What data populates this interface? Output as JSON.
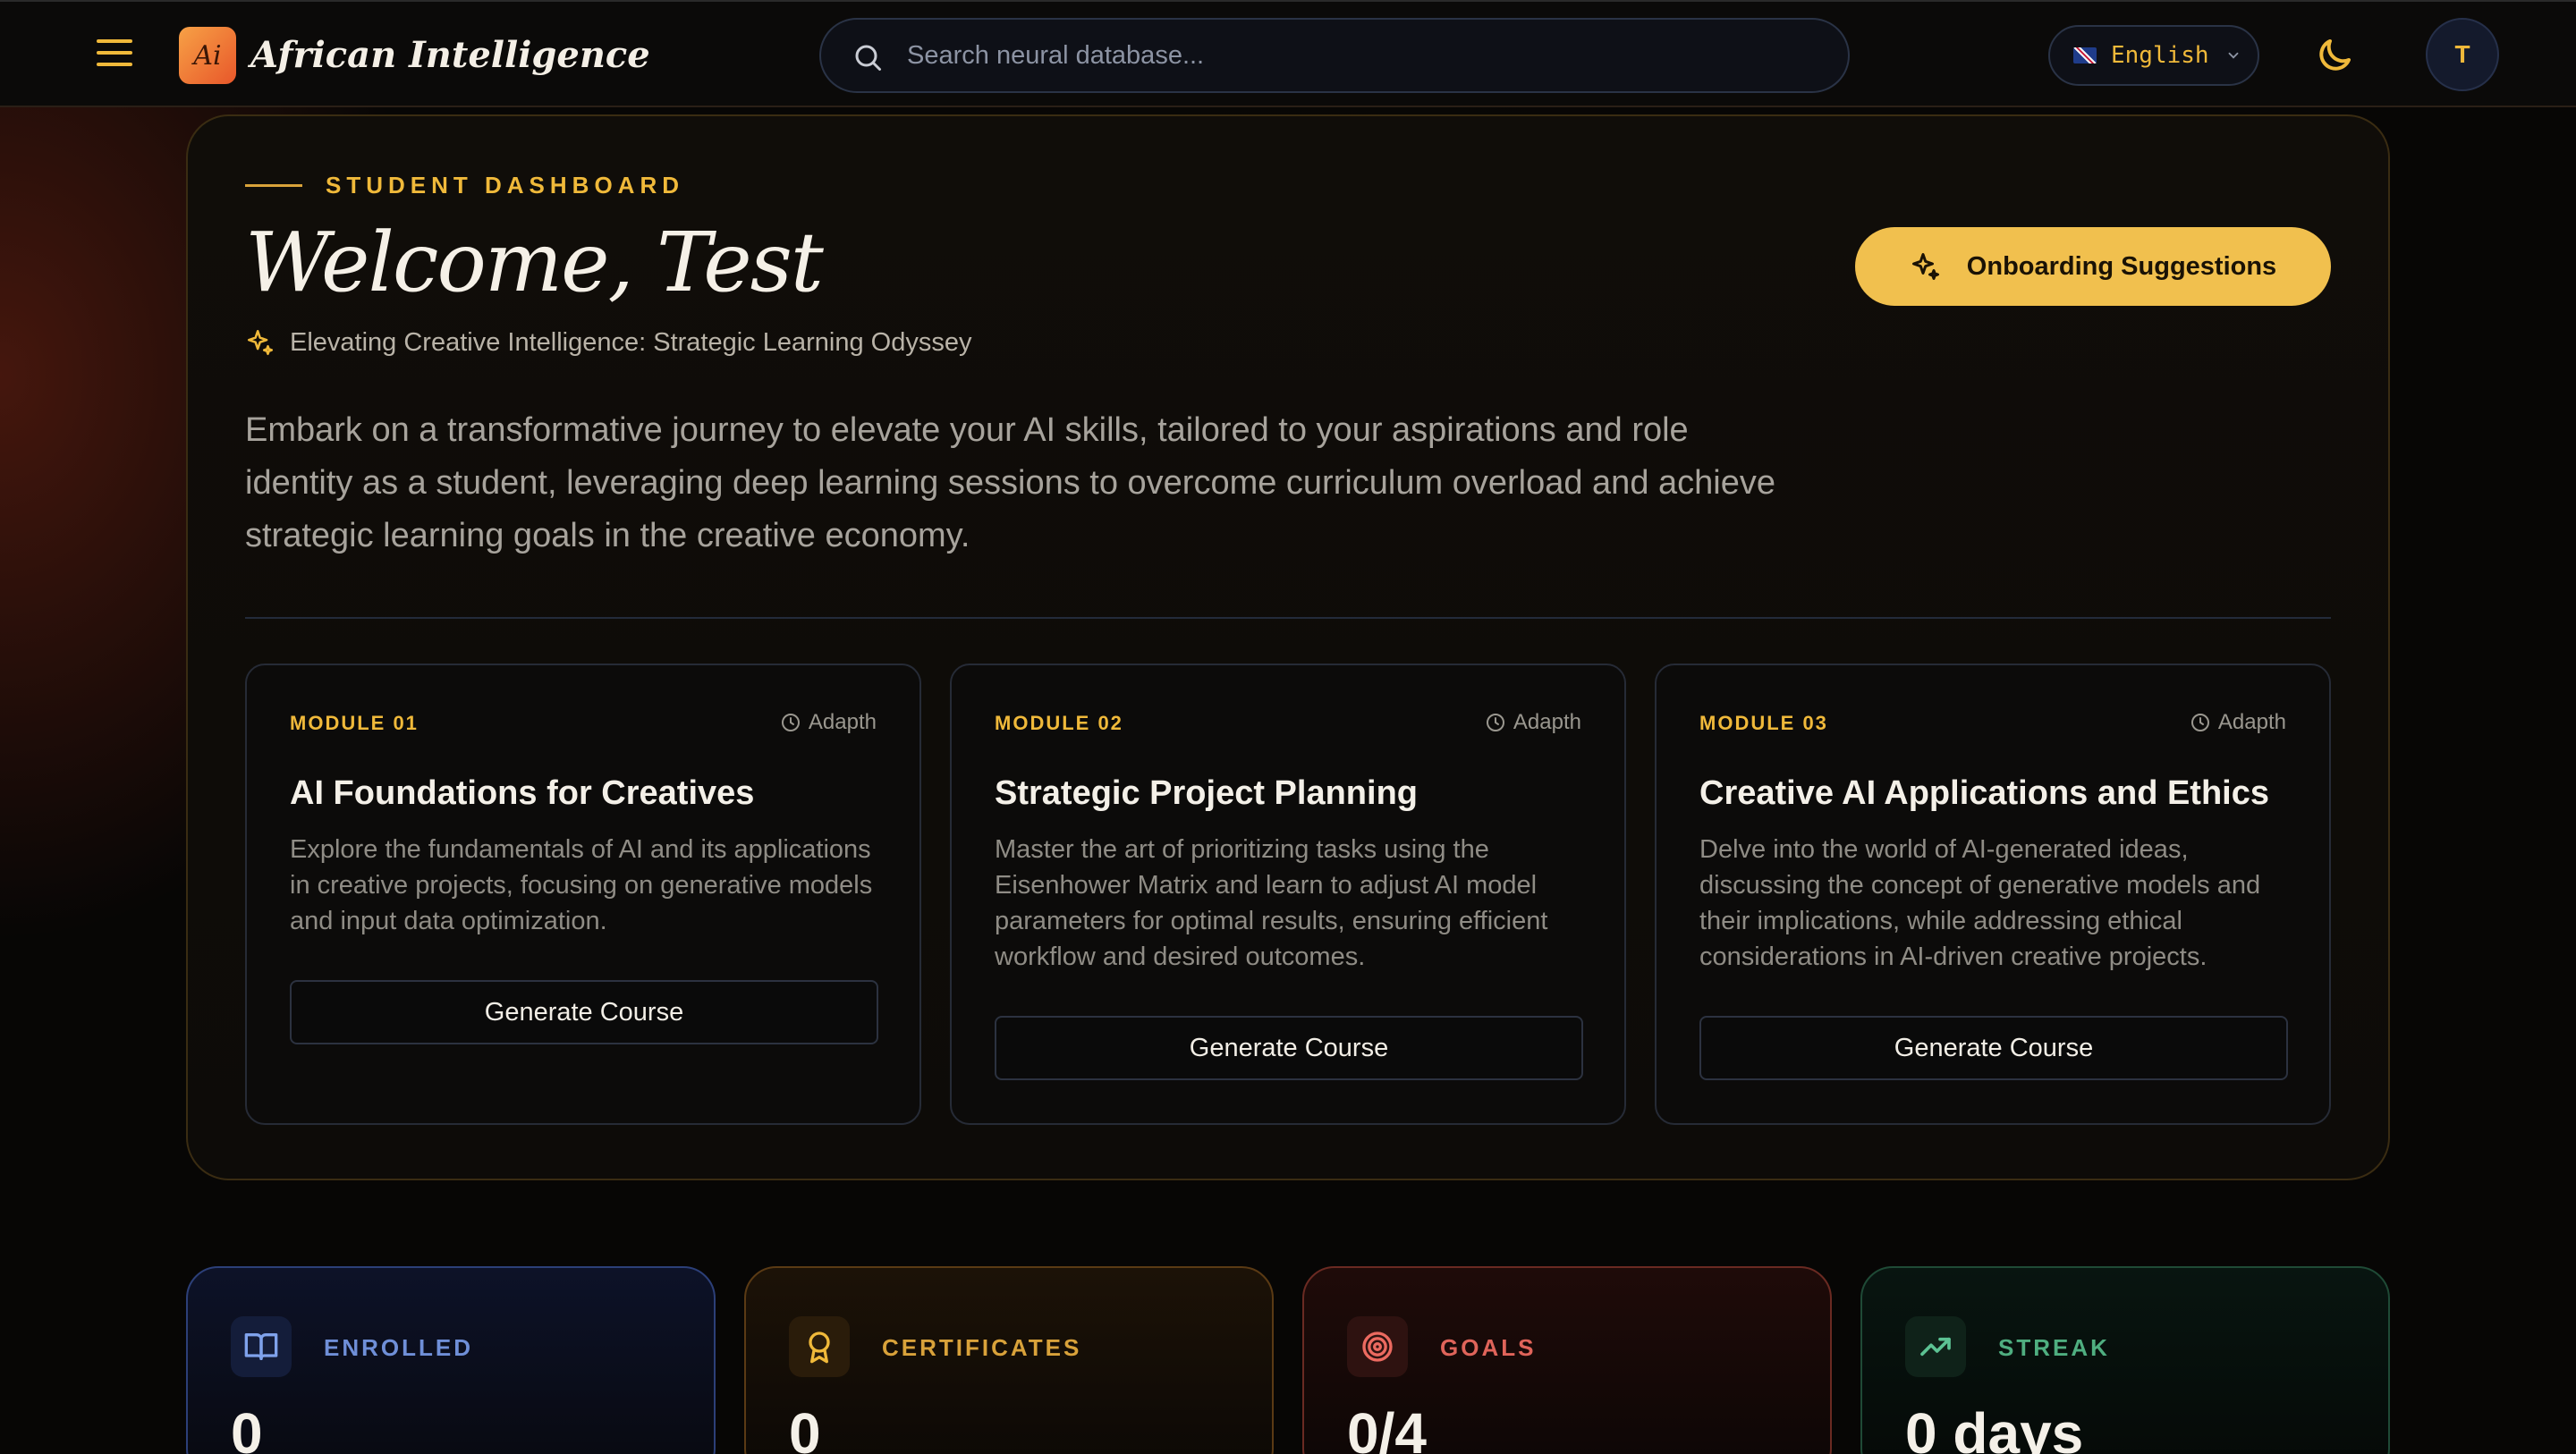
{
  "nav": {
    "logo_text": "Ai",
    "brand": "African Intelligence",
    "search_placeholder": "Search neural database...",
    "language": "English",
    "avatar_initial": "T"
  },
  "hero": {
    "eyebrow": "STUDENT DASHBOARD",
    "welcome": "Welcome, Test",
    "tagline": "Elevating Creative Intelligence: Strategic Learning Odyssey",
    "description": "Embark on a transformative journey to elevate your AI skills, tailored to your aspirations and role identity as a student, leveraging deep learning sessions to overcome curriculum overload and achieve strategic learning goals in the creative economy.",
    "onboarding_button": "Onboarding Suggestions"
  },
  "modules": [
    {
      "number": "MODULE 01",
      "tag": "Adapth",
      "title": "AI Foundations for Creatives",
      "description": "Explore the fundamentals of AI and its applications in creative projects, focusing on generative models and input data optimization.",
      "button": "Generate Course"
    },
    {
      "number": "MODULE 02",
      "tag": "Adapth",
      "title": "Strategic Project Planning",
      "description": "Master the art of prioritizing tasks using the Eisenhower Matrix and learn to adjust AI model parameters for optimal results, ensuring efficient workflow and desired outcomes.",
      "button": "Generate Course"
    },
    {
      "number": "MODULE 03",
      "tag": "Adapth",
      "title": "Creative AI Applications and Ethics",
      "description": "Delve into the world of AI-generated ideas, discussing the concept of generative models and their implications, while addressing ethical considerations in AI-driven creative projects.",
      "button": "Generate Course"
    }
  ],
  "stats": [
    {
      "label": "ENROLLED",
      "value": "0",
      "icon": "book-open-icon",
      "color": "#6f8fd8"
    },
    {
      "label": "CERTIFICATES",
      "value": "0",
      "icon": "award-icon",
      "color": "#d9a23a"
    },
    {
      "label": "GOALS",
      "value": "0/4",
      "icon": "target-icon",
      "color": "#e0645a"
    },
    {
      "label": "STREAK",
      "value": "0 days",
      "icon": "trending-up-icon",
      "color": "#4fae80"
    }
  ],
  "colors": {
    "accent": "#f1c04e",
    "background": "#070605"
  }
}
